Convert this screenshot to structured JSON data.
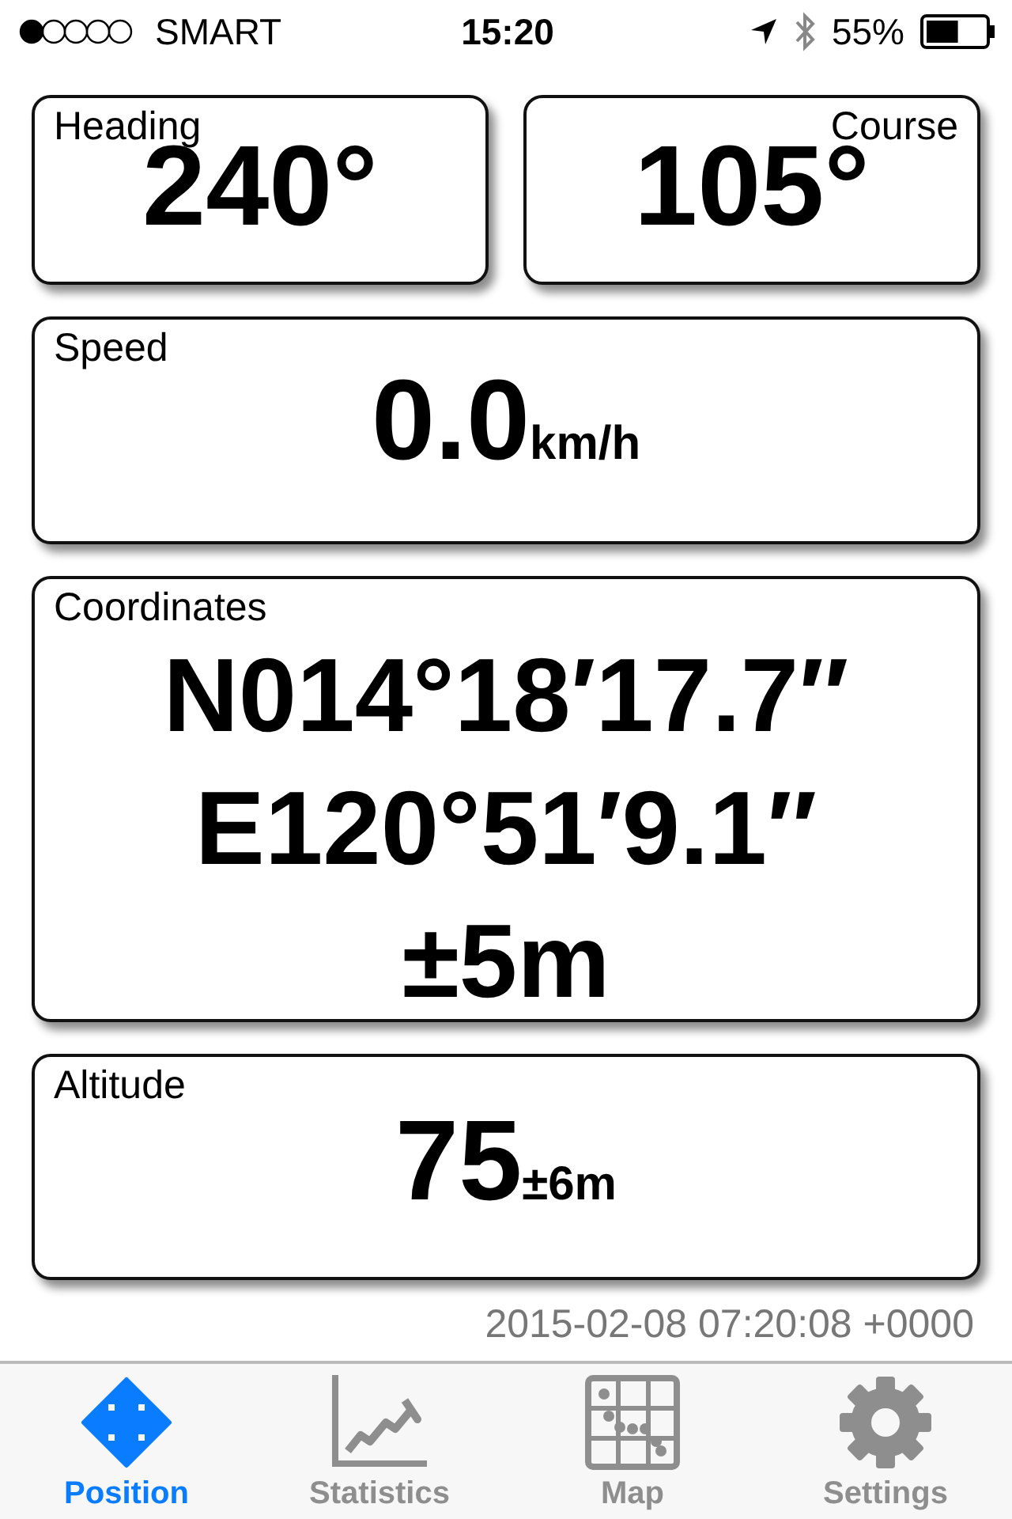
{
  "status_bar": {
    "carrier": "SMART",
    "time": "15:20",
    "battery": "55%"
  },
  "heading": {
    "label": "Heading",
    "value": "240°"
  },
  "course": {
    "label": "Course",
    "value": "105°"
  },
  "speed": {
    "label": "Speed",
    "value": "0.0",
    "unit": "km/h"
  },
  "coordinates": {
    "label": "Coordinates",
    "lines": [
      "N014°18′17.7″",
      "E120°51′9.1″",
      "±5m"
    ]
  },
  "altitude": {
    "label": "Altitude",
    "value": "75",
    "unit": "±6m"
  },
  "timestamp": "2015-02-08 07:20:08 +0000",
  "tabs": [
    {
      "label": "Position",
      "kind": "move",
      "selected": true
    },
    {
      "label": "Statistics",
      "kind": "chart",
      "selected": false
    },
    {
      "label": "Map",
      "kind": "map",
      "selected": false
    },
    {
      "label": "Settings",
      "kind": "gear",
      "selected": false
    }
  ]
}
